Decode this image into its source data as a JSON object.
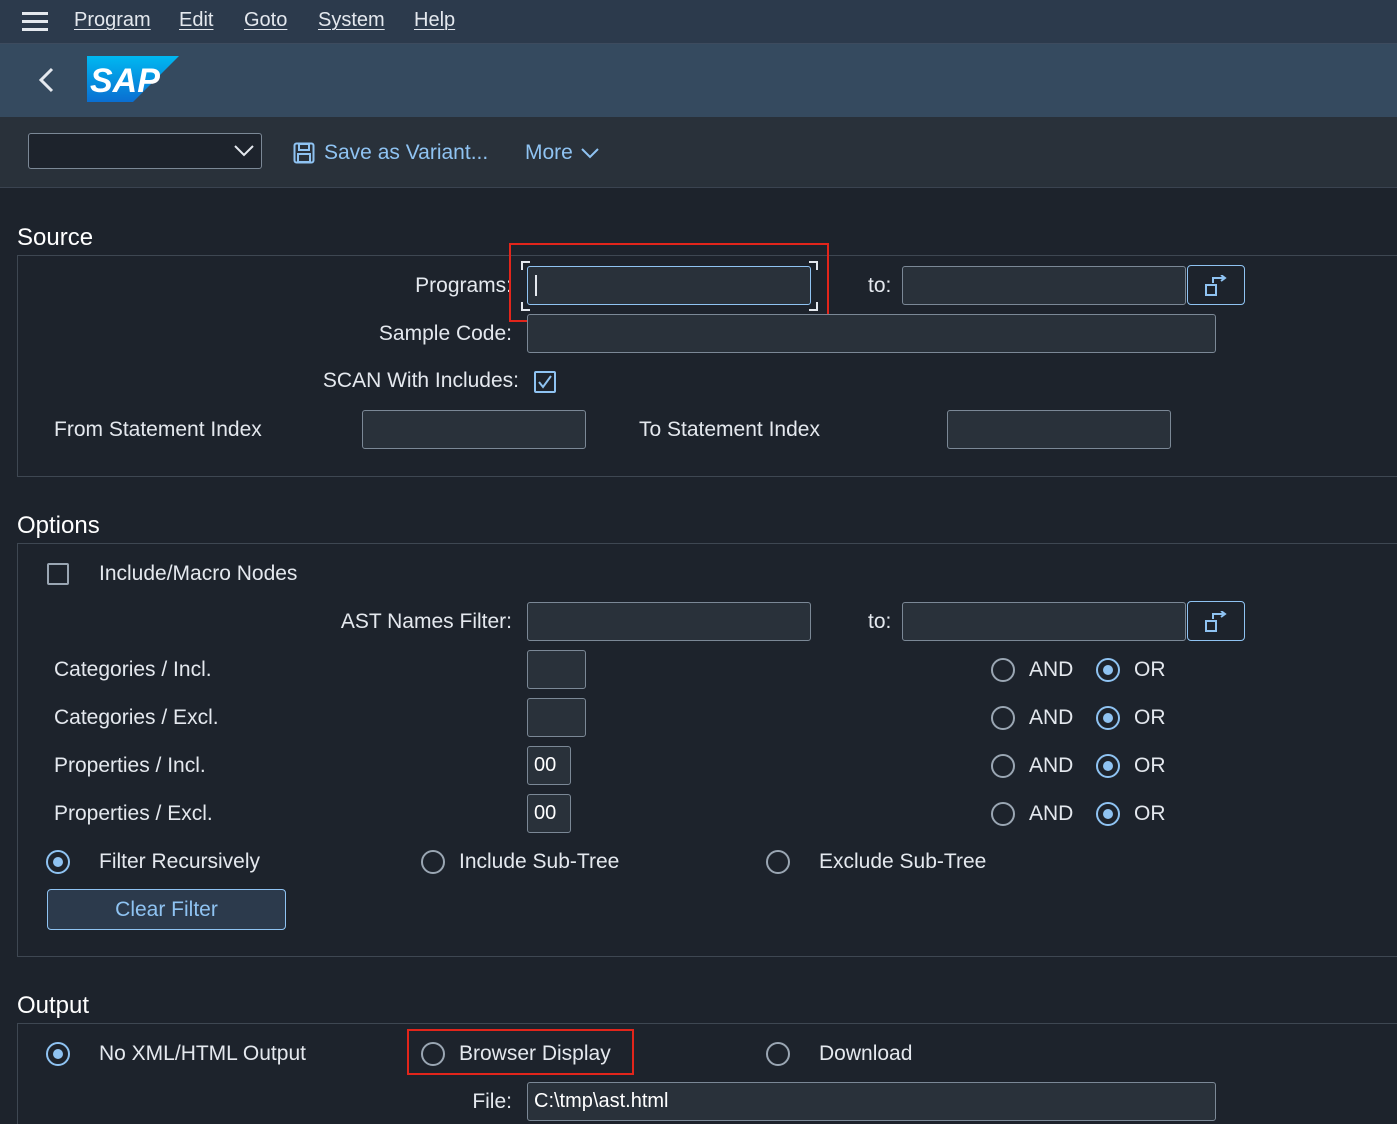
{
  "menu": {
    "items": [
      "Program",
      "Edit",
      "Goto",
      "System",
      "Help"
    ]
  },
  "header": {
    "logo_text": "SAP"
  },
  "toolbar": {
    "variant_value": "",
    "save_variant": "Save as Variant...",
    "more": "More"
  },
  "source": {
    "title": "Source",
    "programs_label": "Programs:",
    "programs_value": "",
    "programs_to_label": "to:",
    "programs_to_value": "",
    "sample_code_label": "Sample Code:",
    "sample_code_value": "",
    "scan_includes_label": "SCAN With Includes:",
    "scan_includes_checked": true,
    "from_index_label": "From Statement Index",
    "from_index_value": "",
    "to_index_label": "To Statement Index",
    "to_index_value": ""
  },
  "options": {
    "title": "Options",
    "include_macro_label": "Include/Macro Nodes",
    "include_macro_checked": false,
    "ast_filter_label": "AST Names Filter:",
    "ast_filter_value": "",
    "ast_to_label": "to:",
    "ast_to_value": "",
    "rows": [
      {
        "label": "Categories / Incl.",
        "value": "",
        "and": "AND",
        "or": "OR",
        "selected": "OR"
      },
      {
        "label": "Categories / Excl.",
        "value": "",
        "and": "AND",
        "or": "OR",
        "selected": "OR"
      },
      {
        "label": "Properties / Incl.",
        "value": "00",
        "and": "AND",
        "or": "OR",
        "selected": "OR"
      },
      {
        "label": "Properties / Excl.",
        "value": "00",
        "and": "AND",
        "or": "OR",
        "selected": "OR"
      }
    ],
    "filter_recursively": "Filter Recursively",
    "include_subtree": "Include Sub-Tree",
    "exclude_subtree": "Exclude Sub-Tree",
    "filter_mode_selected": "Filter Recursively",
    "clear_filter": "Clear Filter"
  },
  "output": {
    "title": "Output",
    "no_output": "No XML/HTML Output",
    "browser_display": "Browser Display",
    "download": "Download",
    "selected": "No XML/HTML Output",
    "file_label": "File:",
    "file_value": "C:\\tmp\\ast.html"
  },
  "colors": {
    "accent": "#8fc3f2",
    "highlight": "#e2251b",
    "shell": "#354a5f",
    "background": "#1d232c"
  }
}
